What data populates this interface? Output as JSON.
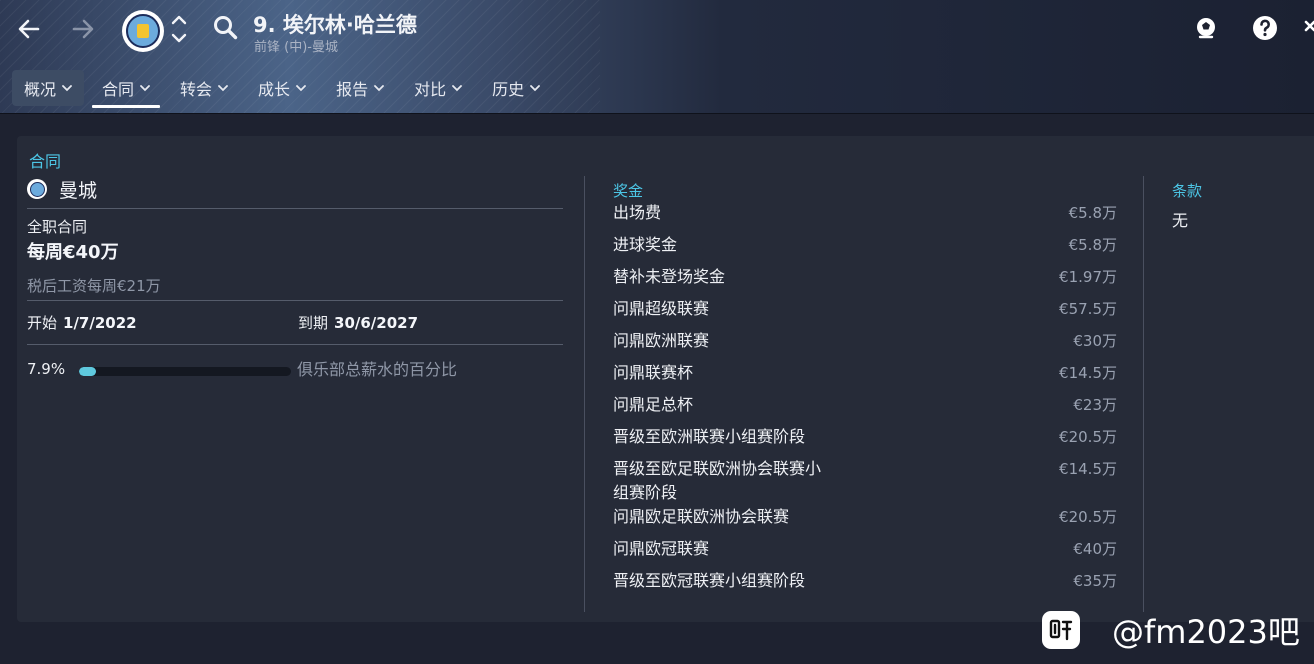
{
  "header": {
    "player_name": "9. 埃尔林·哈兰德",
    "player_sub": "前锋 (中)-曼城"
  },
  "tabs": [
    {
      "label": "概况"
    },
    {
      "label": "合同"
    },
    {
      "label": "转会"
    },
    {
      "label": "成长"
    },
    {
      "label": "报告"
    },
    {
      "label": "对比"
    },
    {
      "label": "历史"
    }
  ],
  "contract": {
    "section_title": "合同",
    "club_name": "曼城",
    "contract_type": "全职合同",
    "wage": "每周€40万",
    "after_tax": "税后工资每周€21万",
    "start_label": "开始",
    "start_date": "1/7/2022",
    "end_label": "到期",
    "end_date": "30/6/2027",
    "wage_pct_text": "7.9%",
    "wage_pct_value": 0.079,
    "wage_pct_label": "俱乐部总薪水的百分比"
  },
  "bonuses": {
    "title": "奖金",
    "items": [
      {
        "name": "出场费",
        "value": "€5.8万"
      },
      {
        "name": "进球奖金",
        "value": "€5.8万"
      },
      {
        "name": "替补未登场奖金",
        "value": "€1.97万"
      },
      {
        "name": "问鼎超级联赛",
        "value": "€57.5万"
      },
      {
        "name": "问鼎欧洲联赛",
        "value": "€30万"
      },
      {
        "name": "问鼎联赛杯",
        "value": "€14.5万"
      },
      {
        "name": "问鼎足总杯",
        "value": "€23万"
      },
      {
        "name": "晋级至欧洲联赛小组赛阶段",
        "value": "€20.5万"
      },
      {
        "name": "晋级至欧足联欧洲协会联赛小组赛阶段",
        "value": "€14.5万"
      },
      {
        "name": "问鼎欧足联欧洲协会联赛",
        "value": "€20.5万"
      },
      {
        "name": "问鼎欧冠联赛",
        "value": "€40万"
      },
      {
        "name": "晋级至欧冠联赛小组赛阶段",
        "value": "€35万"
      }
    ]
  },
  "clauses": {
    "title": "条款",
    "value": "无"
  },
  "watermark": {
    "text": "@fm2023吧"
  },
  "colors": {
    "accent": "#4cc6e6",
    "background": "#1e2230",
    "panel": "#262b38",
    "bar_fill": "#5fc9de"
  },
  "icons": [
    "back-arrow-icon",
    "forward-arrow-icon",
    "club-badge",
    "up-down-icon",
    "search-icon",
    "chevron-down-icon",
    "ball-icon",
    "help-icon",
    "tieba-icon"
  ]
}
